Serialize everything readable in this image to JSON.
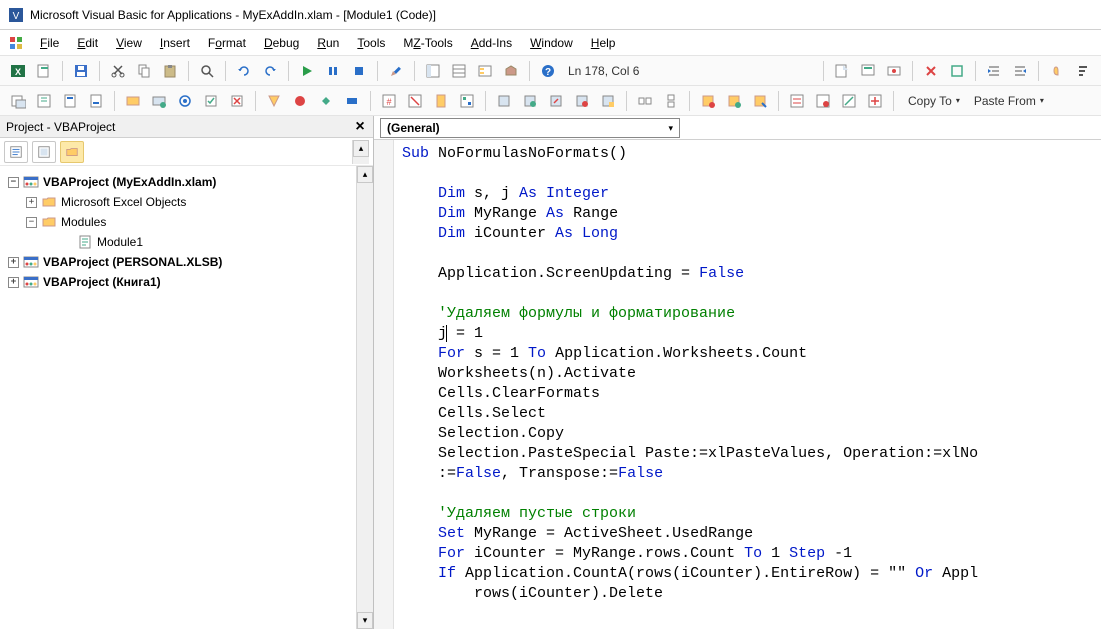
{
  "title": "Microsoft Visual Basic for Applications - MyExAddIn.xlam - [Module1 (Code)]",
  "menu": {
    "file": "File",
    "edit": "Edit",
    "view": "View",
    "insert": "Insert",
    "format": "Format",
    "debug": "Debug",
    "run": "Run",
    "tools": "Tools",
    "mztools": "MZ-Tools",
    "addins": "Add-Ins",
    "window": "Window",
    "help": "Help"
  },
  "status": {
    "position": "Ln 178, Col 6"
  },
  "toolbar2": {
    "copyto": "Copy To",
    "pastefrom": "Paste From"
  },
  "project": {
    "title": "Project - VBAProject",
    "items": [
      {
        "label": "VBAProject (MyExAddIn.xlam)",
        "bold": true,
        "level": 0,
        "expand": "−",
        "icon": "vba"
      },
      {
        "label": "Microsoft Excel Objects",
        "bold": false,
        "level": 1,
        "expand": "+",
        "icon": "folder"
      },
      {
        "label": "Modules",
        "bold": false,
        "level": 1,
        "expand": "−",
        "icon": "folder"
      },
      {
        "label": "Module1",
        "bold": false,
        "level": 3,
        "expand": "",
        "icon": "module"
      },
      {
        "label": "VBAProject (PERSONAL.XLSB)",
        "bold": true,
        "level": 0,
        "expand": "+",
        "icon": "vba"
      },
      {
        "label": "VBAProject (Книга1)",
        "bold": true,
        "level": 0,
        "expand": "+",
        "icon": "vba"
      }
    ]
  },
  "codeHeader": {
    "general": "(General)"
  },
  "code": {
    "tokens": [
      [
        {
          "t": "Sub",
          "c": "kw"
        },
        {
          "t": " NoFormulasNoFormats()"
        }
      ],
      [],
      [
        {
          "t": "    "
        },
        {
          "t": "Dim",
          "c": "kw"
        },
        {
          "t": " s, j "
        },
        {
          "t": "As Integer",
          "c": "kw"
        }
      ],
      [
        {
          "t": "    "
        },
        {
          "t": "Dim",
          "c": "kw"
        },
        {
          "t": " MyRange "
        },
        {
          "t": "As",
          "c": "kw"
        },
        {
          "t": " Range"
        }
      ],
      [
        {
          "t": "    "
        },
        {
          "t": "Dim",
          "c": "kw"
        },
        {
          "t": " iCounter "
        },
        {
          "t": "As Long",
          "c": "kw"
        }
      ],
      [],
      [
        {
          "t": "    Application.ScreenUpdating = "
        },
        {
          "t": "False",
          "c": "kw"
        }
      ],
      [],
      [
        {
          "t": "    "
        },
        {
          "t": "'Удаляем формулы и форматирование",
          "c": "cm"
        }
      ],
      [
        {
          "t": "    j"
        },
        {
          "t": "|",
          "c": "cursor"
        },
        {
          "t": " = 1"
        }
      ],
      [
        {
          "t": "    "
        },
        {
          "t": "For",
          "c": "kw"
        },
        {
          "t": " s = 1 "
        },
        {
          "t": "To",
          "c": "kw"
        },
        {
          "t": " Application.Worksheets.Count"
        }
      ],
      [
        {
          "t": "    Worksheets(n).Activate"
        }
      ],
      [
        {
          "t": "    Cells.ClearFormats"
        }
      ],
      [
        {
          "t": "    Cells.Select"
        }
      ],
      [
        {
          "t": "    Selection.Copy"
        }
      ],
      [
        {
          "t": "    Selection.PasteSpecial Paste:=xlPasteValues, Operation:=xlNo"
        }
      ],
      [
        {
          "t": "    :="
        },
        {
          "t": "False",
          "c": "kw"
        },
        {
          "t": ", Transpose:="
        },
        {
          "t": "False",
          "c": "kw"
        }
      ],
      [],
      [
        {
          "t": "    "
        },
        {
          "t": "'Удаляем пустые строки",
          "c": "cm"
        }
      ],
      [
        {
          "t": "    "
        },
        {
          "t": "Set",
          "c": "kw"
        },
        {
          "t": " MyRange = ActiveSheet.UsedRange"
        }
      ],
      [
        {
          "t": "    "
        },
        {
          "t": "For",
          "c": "kw"
        },
        {
          "t": " iCounter = MyRange.rows.Count "
        },
        {
          "t": "To",
          "c": "kw"
        },
        {
          "t": " 1 "
        },
        {
          "t": "Step",
          "c": "kw"
        },
        {
          "t": " -1"
        }
      ],
      [
        {
          "t": "    "
        },
        {
          "t": "If",
          "c": "kw"
        },
        {
          "t": " Application.CountA(rows(iCounter).EntireRow) = \"\" "
        },
        {
          "t": "Or",
          "c": "kw"
        },
        {
          "t": " Appl"
        }
      ],
      [
        {
          "t": "        rows(iCounter).Delete"
        }
      ]
    ]
  }
}
